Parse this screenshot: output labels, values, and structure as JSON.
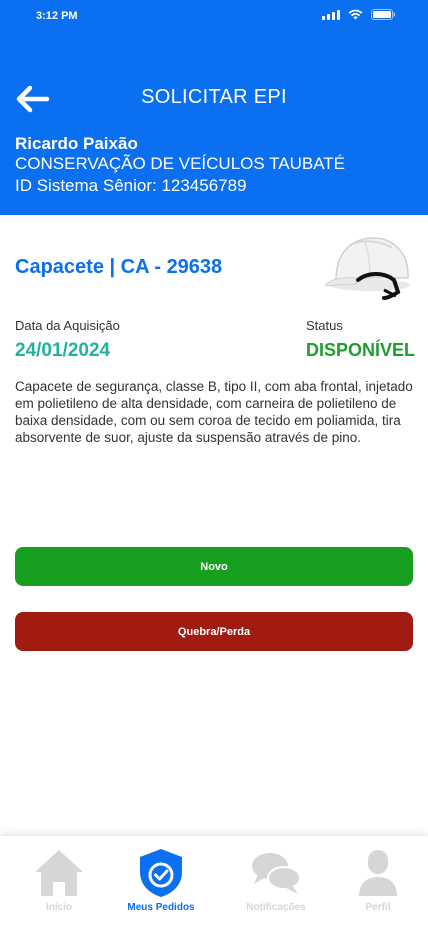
{
  "status_bar": {
    "time": "3:12 PM"
  },
  "header": {
    "title": "SOLICITAR EPI",
    "user_name": "Ricardo Paixão",
    "organization": "CONSERVAÇÃO DE VEÍCULOS TAUBATÉ",
    "system_id": "ID Sistema Sênior: 123456789"
  },
  "product": {
    "title": "Capacete | CA - 29638",
    "acquisition_label": "Data da Aquisição",
    "acquisition_date": "24/01/2024",
    "status_label": "Status",
    "status_value": "DISPONÍVEL",
    "description": "Capacete de segurança, classe B, tipo II, com aba frontal, injetado em polietileno de alta densidade, com carneira de polietileno de baixa densidade, com ou sem coroa de tecido em poliamida, tira absorvente de suor, ajuste da suspensão através de pino."
  },
  "actions": {
    "new_label": "Novo",
    "broken_label": "Quebra/Perda"
  },
  "nav": {
    "home": "Início",
    "orders": "Meus Pedidos",
    "notifications": "Notificações",
    "profile": "Perfil"
  },
  "colors": {
    "primary": "#0a6ff0",
    "date": "#20b2a0",
    "status_available": "#1e9e2e",
    "button_new": "#17a020",
    "button_broken": "#a01b12",
    "nav_inactive": "#d6d6d6"
  }
}
